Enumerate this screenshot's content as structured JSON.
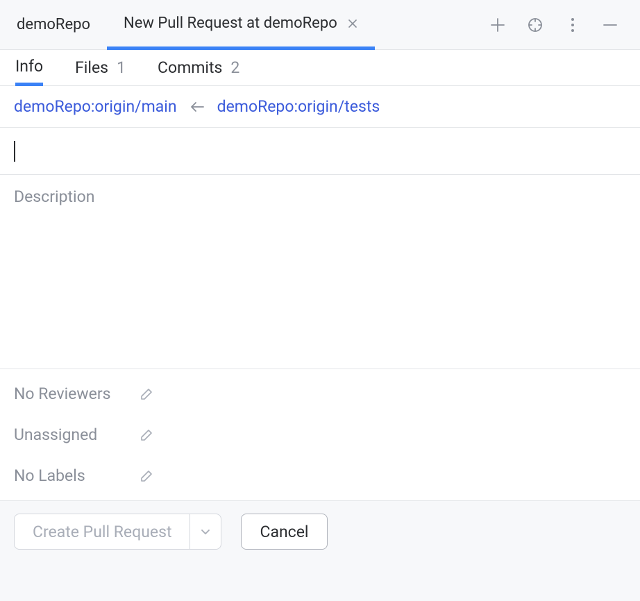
{
  "topTabs": {
    "repo": "demoRepo",
    "activeTitle": "New Pull Request at demoRepo"
  },
  "subTabs": {
    "info": "Info",
    "files": {
      "label": "Files",
      "count": "1"
    },
    "commits": {
      "label": "Commits",
      "count": "2"
    }
  },
  "branches": {
    "target": "demoRepo:origin/main",
    "source": "demoRepo:origin/tests"
  },
  "description": {
    "placeholder": "Description"
  },
  "meta": {
    "reviewers": "No Reviewers",
    "assignees": "Unassigned",
    "labels": "No Labels"
  },
  "buttons": {
    "create": "Create Pull Request",
    "cancel": "Cancel"
  }
}
